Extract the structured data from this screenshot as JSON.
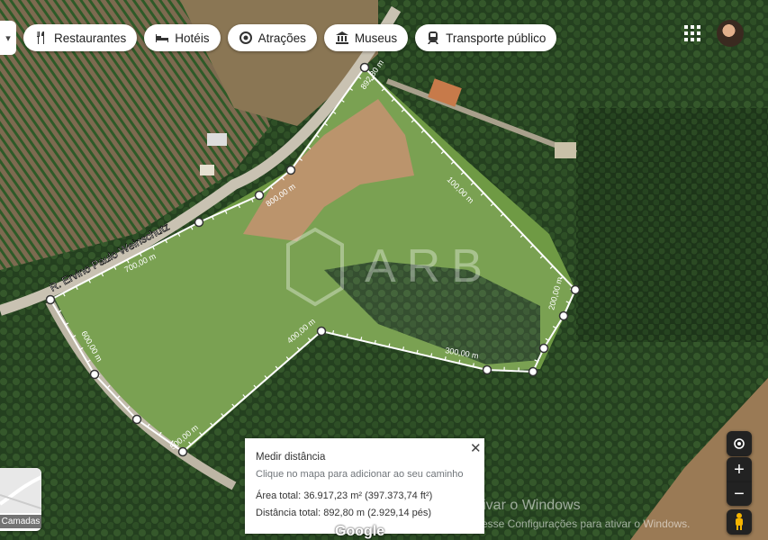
{
  "map": {
    "road_name": "R. Ervino Paulo Weinschutz",
    "watermark": "ARB",
    "distance_labels": [
      "892,80 m",
      "800,00 m",
      "700,00 m",
      "600,00 m",
      "500,00 m",
      "400,00 m",
      "300,00 m",
      "200,00 m",
      "100,00 m"
    ]
  },
  "chips": [
    {
      "label": "Restaurantes",
      "icon": "fork-knife-icon"
    },
    {
      "label": "Hotéis",
      "icon": "bed-icon"
    },
    {
      "label": "Atrações",
      "icon": "camera-icon"
    },
    {
      "label": "Museus",
      "icon": "museum-icon"
    },
    {
      "label": "Transporte público",
      "icon": "train-icon"
    }
  ],
  "layers_label": "Camadas",
  "measure_panel": {
    "title": "Medir distância",
    "hint": "Clique no mapa para adicionar ao seu caminho",
    "area": "Área total: 36.917,23 m² (397.373,74 ft²)",
    "distance": "Distância total: 892,80 m (2.929,14 pés)"
  },
  "controls": {
    "zoom_in": "+",
    "zoom_out": "−"
  },
  "footer": {
    "google": "Google"
  },
  "windows_notice": {
    "line1": "Ativar o Windows",
    "line2": "Acesse Configurações para ativar o Windows."
  },
  "colors": {
    "line": "#ffffff",
    "forest": "#2b4a24",
    "field": "#6c9a3e",
    "dirt": "#b98a5a"
  }
}
